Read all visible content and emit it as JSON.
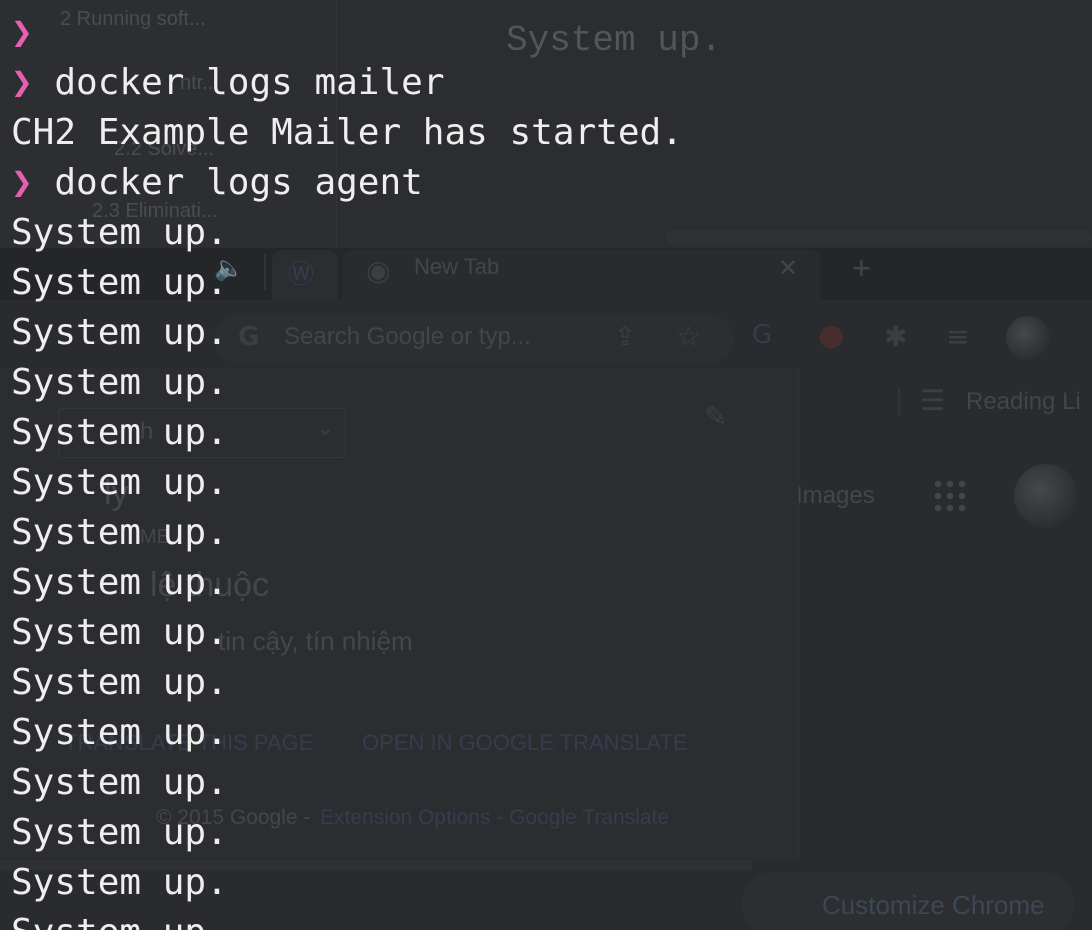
{
  "background": {
    "sidebar_toc": [
      "2 Running soft...",
      "ntr...",
      "2.2 Solve...",
      "2.3 Eliminati..."
    ],
    "editor_line": "System up.",
    "chrome_tabs": {
      "new_tab_label": "New Tab",
      "close_symbol": "✕",
      "new_tab_plus": "+"
    },
    "omnibox_placeholder": "Search Google or typ...",
    "reading_list": "Reading Li",
    "images_link": "Images",
    "popup": {
      "select_value": "h",
      "word_heading": "ly",
      "label": "ME",
      "phonetic": "lệ thuộc",
      "meaning": "tin cậy, tín nhiệm",
      "translate_page": "TRANSLATE THIS PAGE",
      "open_in_translate": "OPEN IN GOOGLE TRANSLATE",
      "footer_copyright": "© 2015 Google -",
      "footer_links": "Extension Options - Google Translate"
    },
    "customize_chrome": "Customize Chrome",
    "icons": [
      "chevron-down-icon",
      "pencil-icon",
      "star-icon",
      "share-icon",
      "puzzle-icon",
      "apps-grid-icon",
      "google-g-icon",
      "chrome-logo-icon",
      "wordpress-icon",
      "speaker-icon"
    ]
  },
  "terminal": {
    "prompt_symbol": "❯",
    "lines": [
      {
        "type": "prompt",
        "command": ""
      },
      {
        "type": "prompt",
        "command": "docker logs mailer"
      },
      {
        "type": "output",
        "text": "CH2 Example Mailer has started."
      },
      {
        "type": "prompt",
        "command": "docker logs agent"
      },
      {
        "type": "output",
        "text": "System up."
      },
      {
        "type": "output",
        "text": "System up."
      },
      {
        "type": "output",
        "text": "System up."
      },
      {
        "type": "output",
        "text": "System up."
      },
      {
        "type": "output",
        "text": "System up."
      },
      {
        "type": "output",
        "text": "System up."
      },
      {
        "type": "output",
        "text": "System up."
      },
      {
        "type": "output",
        "text": "System up."
      },
      {
        "type": "output",
        "text": "System up."
      },
      {
        "type": "output",
        "text": "System up."
      },
      {
        "type": "output",
        "text": "System up."
      },
      {
        "type": "output",
        "text": "System up."
      },
      {
        "type": "output",
        "text": "System up."
      },
      {
        "type": "output",
        "text": "System up."
      },
      {
        "type": "output",
        "text": "System up."
      }
    ]
  }
}
